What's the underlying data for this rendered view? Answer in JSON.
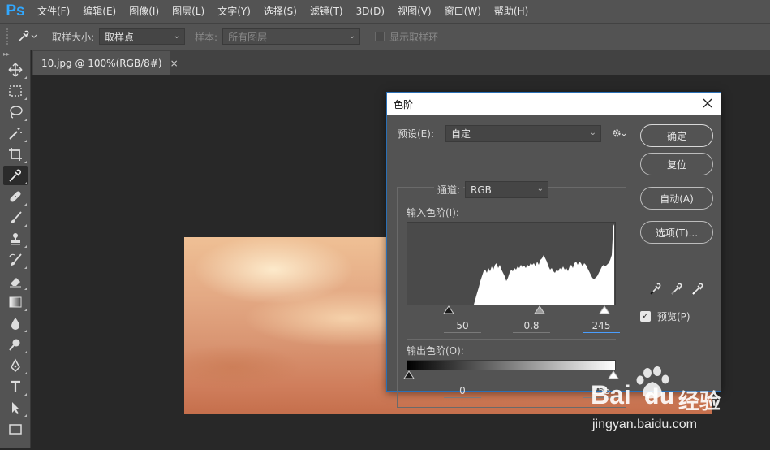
{
  "menubar": {
    "logo": "Ps",
    "items": [
      "文件(F)",
      "编辑(E)",
      "图像(I)",
      "图层(L)",
      "文字(Y)",
      "选择(S)",
      "滤镜(T)",
      "3D(D)",
      "视图(V)",
      "窗口(W)",
      "帮助(H)"
    ]
  },
  "options": {
    "sample_size_label": "取样大小:",
    "sample_size_value": "取样点",
    "sample_label": "样本:",
    "sample_value": "所有图层",
    "show_ring_label": "显示取样环"
  },
  "document": {
    "tab_title": "10.jpg @ 100%(RGB/8#)",
    "tab_close": "×"
  },
  "levels_dialog": {
    "title": "色阶",
    "preset_label": "预设(E):",
    "preset_value": "自定",
    "channel_label": "通道:",
    "channel_value": "RGB",
    "input_levels_label": "输入色阶(I):",
    "input_black": "50",
    "input_gamma": "0.8",
    "input_white": "245",
    "output_levels_label": "输出色阶(O):",
    "output_black": "0",
    "output_white": "255",
    "buttons": {
      "ok": "确定",
      "reset": "复位",
      "auto": "自动(A)",
      "options": "选项(T)..."
    },
    "preview_label": "预览(P)",
    "preview_checked": true
  },
  "watermark": {
    "brand": "Bai",
    "brand_suffix": "经验",
    "url": "jingyan.baidu.com"
  },
  "colors": {
    "ps_blue": "#31a8ff",
    "dialog_border": "#2a6fb5",
    "focus": "#4a9eff"
  }
}
